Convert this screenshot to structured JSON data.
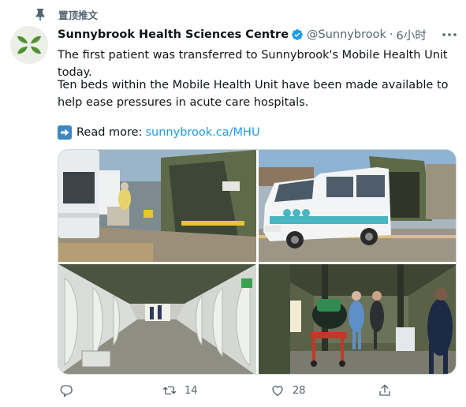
{
  "pinned": {
    "label": "置顶推文",
    "icon": "pin-icon"
  },
  "author": {
    "name": "Sunnybrook Health Sciences Centre",
    "handle": "@Sunnybrook",
    "separator": "·",
    "time": "6小时",
    "verified_icon": "verified-badge-icon",
    "avatar_icon": "sunnybrook-leaf-logo-icon"
  },
  "tweet": {
    "line1": "The first patient was transferred to Sunnybrook's Mobile Health Unit today.",
    "line2": "Ten beds within the Mobile Health Unit have been made available to help ease pressures in acute care hospitals.",
    "read_more_label": "Read more:",
    "link_text": "sunnybrook.ca/MHU",
    "read_more_icon": "right-arrow-emoji-icon"
  },
  "media": {
    "photo_count": 4,
    "subjects": [
      "ambulance-tent-photo",
      "van-photo",
      "tent-interior-photo",
      "patient-transfer-photo"
    ]
  },
  "actions": {
    "reply_count": "",
    "retweet_count": "14",
    "like_count": "28",
    "share_count": ""
  },
  "colors": {
    "link": "#1d9bf0",
    "secondary_text": "#536471",
    "verified": "#1d9bf0"
  }
}
